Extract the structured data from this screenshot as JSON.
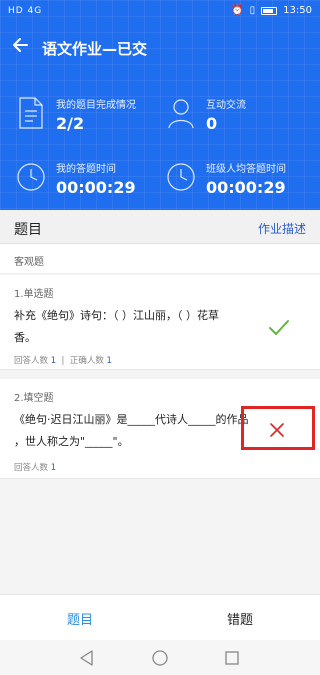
{
  "status_bar": {
    "left_text": "HD 4G",
    "time": "13:50"
  },
  "header": {
    "title": "语文作业—已交"
  },
  "stats": [
    {
      "label": "我的题目完成情况",
      "value": "2/2"
    },
    {
      "label": "互动交流",
      "value": "0"
    },
    {
      "label": "我的答题时间",
      "value": "00:00:29"
    },
    {
      "label": "班级人均答题时间",
      "value": "00:00:29"
    }
  ],
  "section_header": {
    "title": "题目",
    "link": "作业描述"
  },
  "category": "客观题",
  "questions": [
    {
      "type": "1.单选题",
      "lines": [
        "补充《绝句》诗句：（     ）江山丽，（     ）花草",
        "香。"
      ],
      "answer_label": "回答人数",
      "answer_count": "1",
      "correct_label": "正确人数",
      "correct_count": "1",
      "result": "correct"
    },
    {
      "type": "2.填空题",
      "lines": [
        "《绝句·迟日江山丽》是_____代诗人_____的作品",
        "，世人称之为\"_____\"。"
      ],
      "answer_label": "回答人数",
      "answer_count": "1",
      "result": "wrong"
    }
  ],
  "bottom_tabs": [
    {
      "label": "题目",
      "active": true
    },
    {
      "label": "错题",
      "active": false
    }
  ],
  "colors": {
    "primary": "#1f6ef0",
    "correct": "#5cb83a",
    "wrong": "#e02525",
    "tab_active": "#2a8fe0"
  }
}
